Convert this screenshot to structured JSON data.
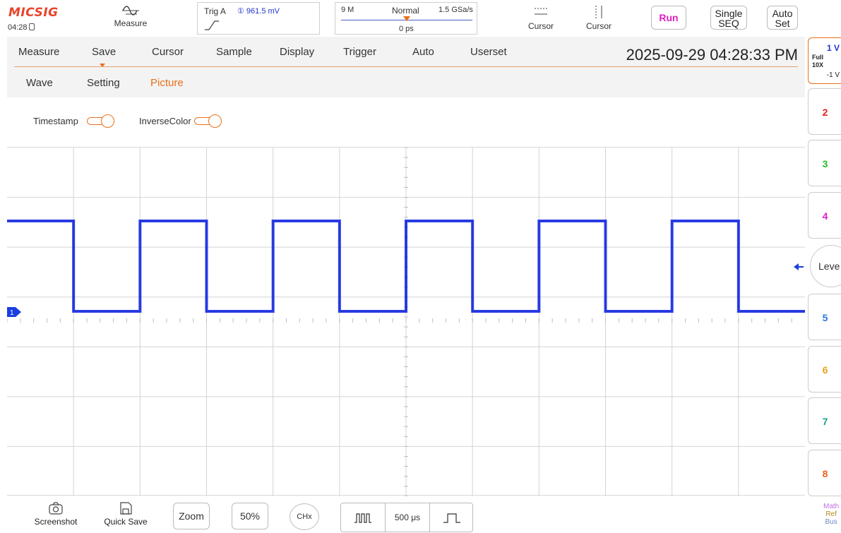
{
  "topbar": {
    "logo": "MICSIG",
    "clock": "04:28",
    "measure_label": "Measure",
    "trigger": {
      "label": "Trig A",
      "value": "① 961.5 mV"
    },
    "timebase": {
      "memory": "9 M",
      "mode": "Normal",
      "sample_rate": "1.5 GSa/s",
      "delay": "0 ps"
    },
    "cursor_h_label": "Cursor",
    "cursor_v_label": "Cursor",
    "run_label": "Run",
    "single_label_1": "Single",
    "single_label_2": "SEQ",
    "auto_label_1": "Auto",
    "auto_label_2": "Set"
  },
  "menu": {
    "tabs": [
      "Measure",
      "Save",
      "Cursor",
      "Sample",
      "Display",
      "Trigger",
      "Auto",
      "Userset"
    ],
    "active_tab": "Save",
    "datetime": "2025-09-29 04:28:33 PM",
    "subtabs": [
      "Wave",
      "Setting",
      "Picture"
    ],
    "active_subtab": "Picture",
    "options": [
      {
        "label": "Timestamp",
        "on": true
      },
      {
        "label": "InverseColor",
        "on": true
      }
    ]
  },
  "screen": {
    "ch1_marker": "1",
    "trace_color": "#1a2ee0",
    "grid_color": "#d4d4d4",
    "periods_visible": 6,
    "duty_cycle": 0.5
  },
  "sidebar": {
    "ch1": {
      "scale": "1 V",
      "bandwidth": "Full",
      "probe": "10X",
      "offset": "-1 V"
    },
    "channels": [
      {
        "label": "2",
        "color": "#e02020"
      },
      {
        "label": "3",
        "color": "#22c020"
      },
      {
        "label": "4",
        "color": "#e020c8"
      },
      {
        "label": "5",
        "color": "#2a78e0"
      },
      {
        "label": "6",
        "color": "#e8a020"
      },
      {
        "label": "7",
        "color": "#18a090"
      },
      {
        "label": "8",
        "color": "#e86020"
      }
    ],
    "level_label": "Leve",
    "math_label": "Math",
    "ref_label": "Ref",
    "bus_label": "Bus"
  },
  "bottombar": {
    "screenshot_label": "Screenshot",
    "quicksave_label": "Quick Save",
    "zoom_label": "Zoom",
    "fifty_label": "50%",
    "chx_label": "CHx",
    "timebase_label": "500 μs"
  }
}
